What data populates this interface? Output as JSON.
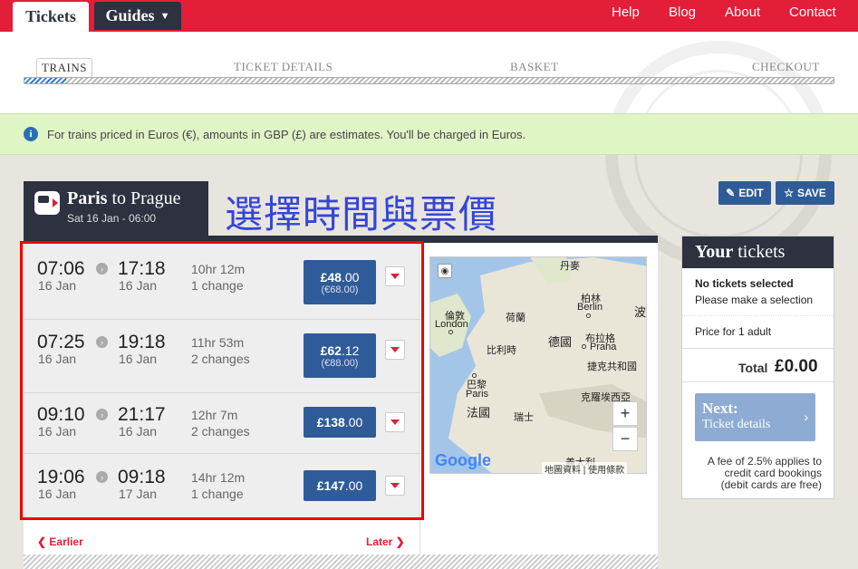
{
  "nav": {
    "tabs": [
      {
        "label": "Tickets"
      },
      {
        "label": "Guides"
      }
    ],
    "links": [
      "Help",
      "Blog",
      "About",
      "Contact"
    ]
  },
  "steps": [
    "TRAINS",
    "TICKET DETAILS",
    "BASKET",
    "CHECKOUT"
  ],
  "notice": "For trains priced in Euros (€), amounts in GBP (£) are estimates. You'll be charged in Euros.",
  "route": {
    "from": "Paris",
    "to_word": "to",
    "to": "Prague",
    "date": "Sat 16 Jan - 06:00"
  },
  "overlay_text": "選擇時間與票價",
  "actions": {
    "edit": "EDIT",
    "save": "SAVE"
  },
  "journeys": [
    {
      "dep": "07:06",
      "dep_date": "16 Jan",
      "arr": "17:18",
      "arr_date": "16 Jan",
      "duration": "10hr 12m",
      "changes": "1 change",
      "price_main": "£48",
      "price_dec": ".00",
      "price_eur": "(€68.00)"
    },
    {
      "dep": "07:25",
      "dep_date": "16 Jan",
      "arr": "19:18",
      "arr_date": "16 Jan",
      "duration": "11hr 53m",
      "changes": "2 changes",
      "price_main": "£62",
      "price_dec": ".12",
      "price_eur": "(€88.00)"
    },
    {
      "dep": "09:10",
      "dep_date": "16 Jan",
      "arr": "21:17",
      "arr_date": "16 Jan",
      "duration": "12hr 7m",
      "changes": "2 changes",
      "price_main": "£138",
      "price_dec": ".00",
      "price_eur": ""
    },
    {
      "dep": "19:06",
      "dep_date": "16 Jan",
      "arr": "09:18",
      "arr_date": "17 Jan",
      "duration": "14hr 12m",
      "changes": "1 change",
      "price_main": "£147",
      "price_dec": ".00",
      "price_eur": ""
    }
  ],
  "pager": {
    "earlier": "Earlier",
    "later": "Later"
  },
  "map": {
    "labels": [
      "丹麥",
      "柏林",
      "Berlin",
      "倫敦",
      "London",
      "荷蘭",
      "比利時",
      "德國",
      "布拉格",
      "Praha",
      "捷克共和國",
      "巴黎",
      "Paris",
      "法國",
      "瑞士",
      "克羅埃西亞",
      "義大利",
      "波"
    ],
    "zoom_in": "+",
    "zoom_out": "−",
    "logo": "Google",
    "attribution": "地圖資料",
    "terms": "使用條款"
  },
  "tickets": {
    "title_bold": "Your",
    "title_rest": "tickets",
    "none": "No tickets selected",
    "hint": "Please make a selection",
    "price_for": "Price for 1 adult",
    "total_label": "Total",
    "total_value": "£0.00",
    "next_1": "Next:",
    "next_2": "Ticket details",
    "fee": "A fee of 2.5% applies to credit card bookings (debit cards are free)"
  },
  "colors": {
    "brand_red": "#e31e38",
    "navy": "#2d3140",
    "price_blue": "#2f5c98",
    "notice_green": "#dff5c6"
  }
}
